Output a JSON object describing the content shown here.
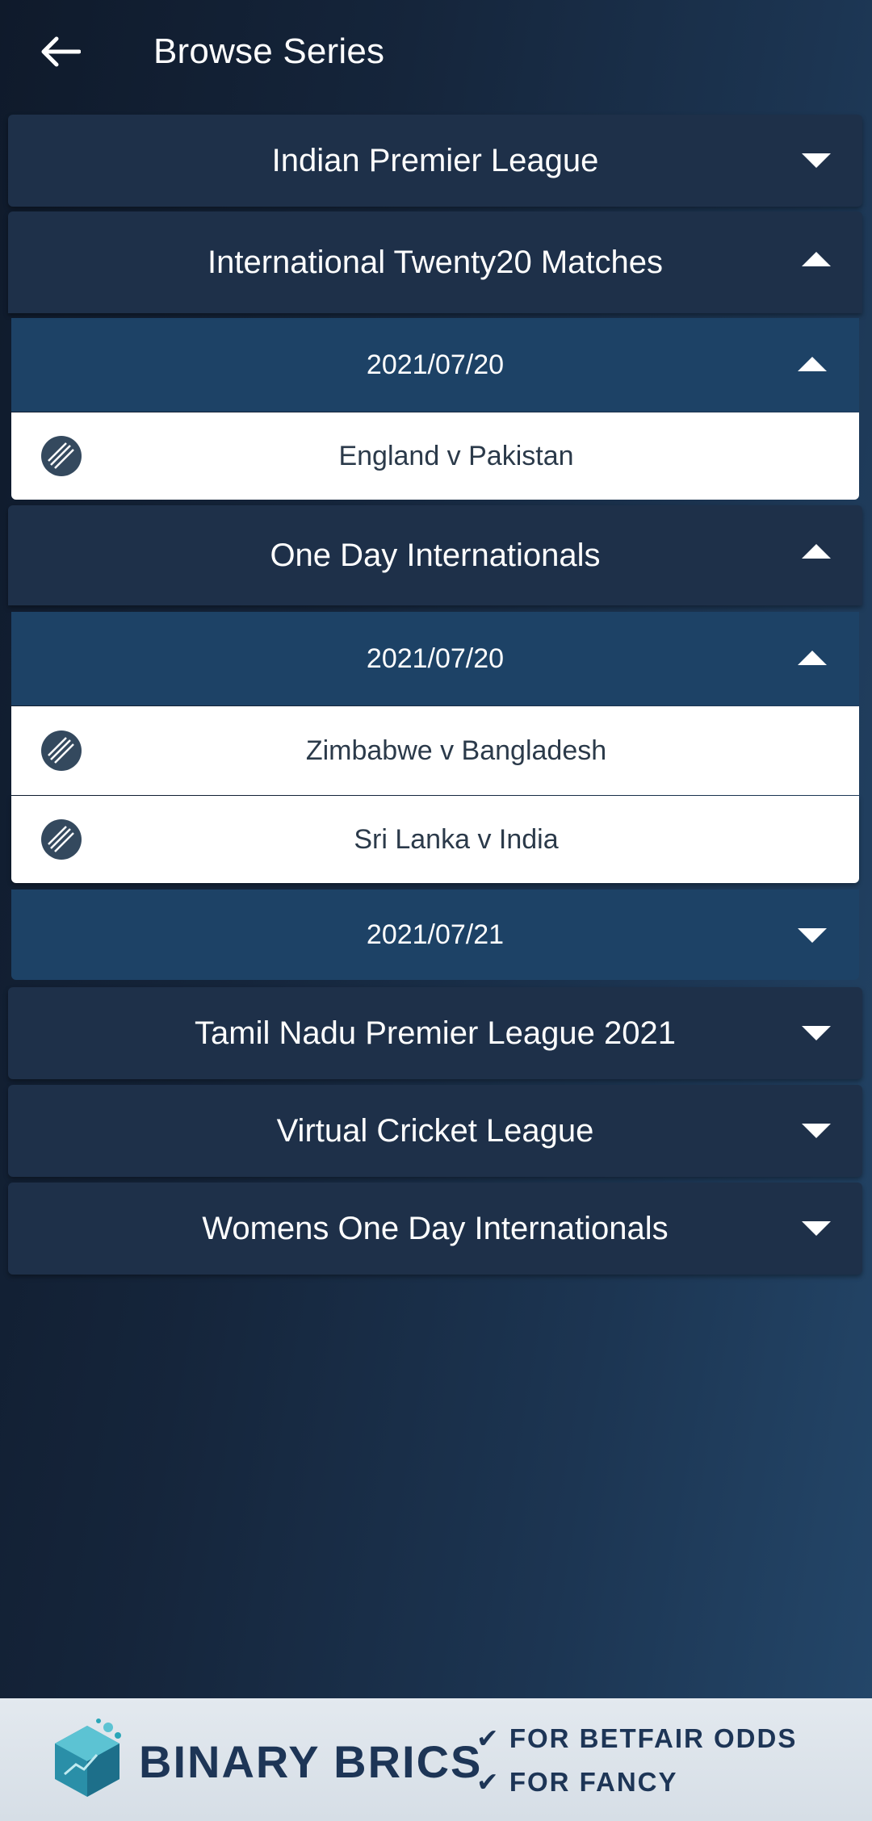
{
  "header": {
    "title": "Browse Series",
    "back_icon": "back-arrow-icon"
  },
  "series": [
    {
      "label": "Indian Premier League",
      "expanded": false
    },
    {
      "label": "International Twenty20 Matches",
      "expanded": true,
      "dates": [
        {
          "label": "2021/07/20",
          "expanded": true,
          "matches": [
            {
              "label": "England v Pakistan"
            }
          ]
        }
      ]
    },
    {
      "label": "One Day Internationals",
      "expanded": true,
      "dates": [
        {
          "label": "2021/07/20",
          "expanded": true,
          "matches": [
            {
              "label": "Zimbabwe v Bangladesh"
            },
            {
              "label": "Sri Lanka v India"
            }
          ]
        },
        {
          "label": "2021/07/21",
          "expanded": false
        }
      ]
    },
    {
      "label": "Tamil Nadu Premier League 2021",
      "expanded": false
    },
    {
      "label": "Virtual Cricket League",
      "expanded": false
    },
    {
      "label": "Womens One Day Internationals",
      "expanded": false
    }
  ],
  "banner": {
    "brand": "BINARY BRICS",
    "features": [
      "✔ FOR BETFAIR ODDS",
      "✔ FOR FANCY"
    ],
    "colors": {
      "brand": "#1d3556",
      "accent": "#2aa6b8"
    }
  },
  "colors": {
    "series_row": "#1e3049",
    "date_row": "#1d4266",
    "match_row": "#ffffff",
    "match_text": "#2b3a4a"
  }
}
